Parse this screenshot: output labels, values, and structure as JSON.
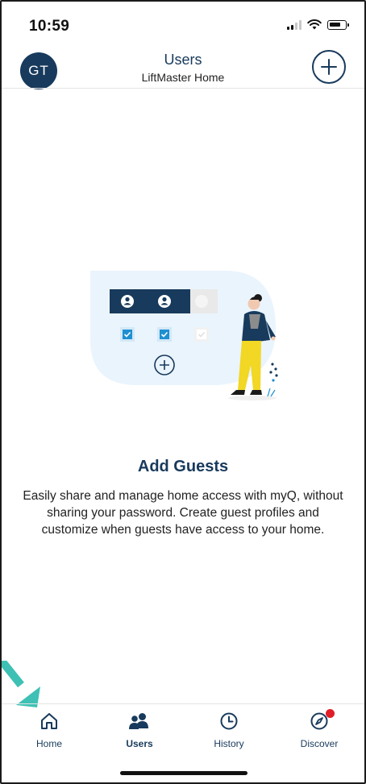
{
  "status": {
    "time": "10:59"
  },
  "header": {
    "avatar_initials": "GT",
    "title": "Users",
    "subtitle": "LiftMaster Home",
    "add_label": "+"
  },
  "content": {
    "heading": "Add Guests",
    "description": "Easily share and manage home access with myQ, without sharing your password. Create guest profiles and customize when guests have access to your home."
  },
  "nav": {
    "items": [
      {
        "label": "Home",
        "icon": "home-icon"
      },
      {
        "label": "Users",
        "icon": "users-icon"
      },
      {
        "label": "History",
        "icon": "clock-icon"
      },
      {
        "label": "Discover",
        "icon": "compass-icon"
      }
    ],
    "active": "Users",
    "discover_badge": true
  },
  "colors": {
    "brand_navy": "#183a5c",
    "accent_blue": "#1e8fd1",
    "badge_red": "#e01e27",
    "arrow_teal": "#3ec1b4",
    "figure_yellow": "#f2d724"
  }
}
